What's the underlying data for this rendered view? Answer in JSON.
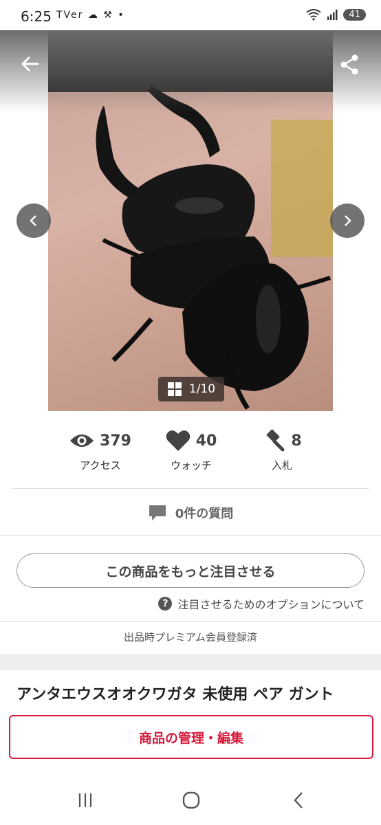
{
  "status_bar": {
    "time": "6:25",
    "notif_icons": "TVer ☁ ⚒ •",
    "battery": "41"
  },
  "gallery": {
    "counter": "1/10"
  },
  "stats": [
    {
      "icon": "eye-icon",
      "value": "379",
      "label": "アクセス"
    },
    {
      "icon": "heart-icon",
      "value": "40",
      "label": "ウォッチ"
    },
    {
      "icon": "gavel-icon",
      "value": "8",
      "label": "入札"
    }
  ],
  "questions": {
    "label": "0件の質問"
  },
  "promote": {
    "button_label": "この商品をもっと注目させる",
    "options_link": "注目させるためのオプションについて"
  },
  "premium_note": "出品時プレミアム会員登録済",
  "item": {
    "title": "アンタエウスオオクワガタ 未使用 ペア ガント"
  },
  "manage": {
    "button_label": "商品の管理・編集"
  },
  "colors": {
    "accent": "#d6193b",
    "text": "#333333"
  }
}
